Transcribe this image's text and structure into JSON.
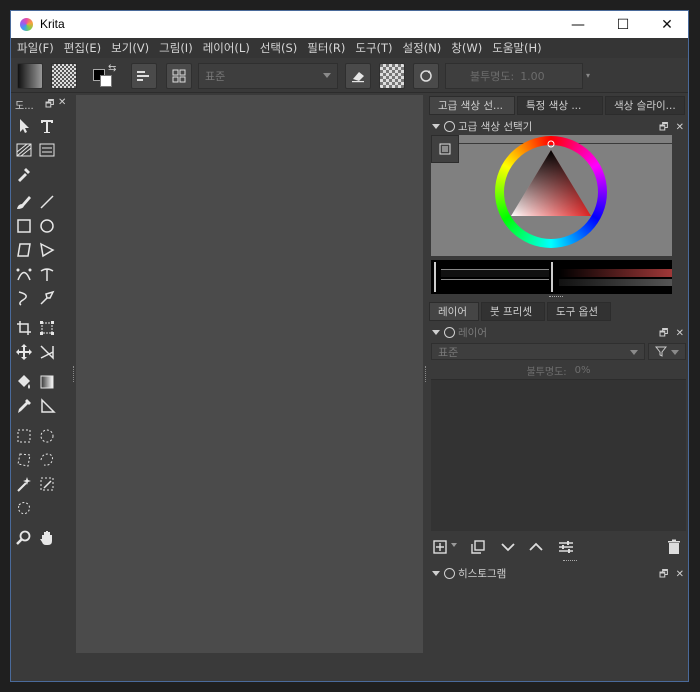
{
  "window": {
    "title": "Krita"
  },
  "window_controls": {
    "minimize": "—",
    "maximize": "☐",
    "close": "✕"
  },
  "menu": [
    "파일(F)",
    "편집(E)",
    "보기(V)",
    "그림(I)",
    "레이어(L)",
    "선택(S)",
    "필터(R)",
    "도구(T)",
    "설정(N)",
    "창(W)",
    "도움말(H)"
  ],
  "toolbar": {
    "blend_mode": "표준",
    "opacity_label": "불투명도:",
    "opacity_value": "1.00"
  },
  "toolbox": {
    "title": "도...",
    "float": "🗗",
    "close": "✕"
  },
  "top_tabs": [
    "고급 색상 선...",
    "특정 색상 ...",
    "색상 슬라이..."
  ],
  "color_panel": {
    "title": "고급 색상 선택기",
    "float": "🗗",
    "close": "✕"
  },
  "bottom_tabs": [
    "레이어",
    "붓 프리셋",
    "도구 옵션"
  ],
  "layers_panel": {
    "title": "레이어",
    "blend_mode": "표준",
    "opacity_label": "불투명도:",
    "opacity_value": "0%",
    "float": "🗗",
    "close": "✕"
  },
  "histogram_panel": {
    "title": "히스토그램",
    "float": "🗗",
    "close": "✕"
  },
  "colors": {
    "window_bg": "#3a3a3a",
    "canvas_bg": "#4b4b4b",
    "accent_red": "#e02020"
  }
}
